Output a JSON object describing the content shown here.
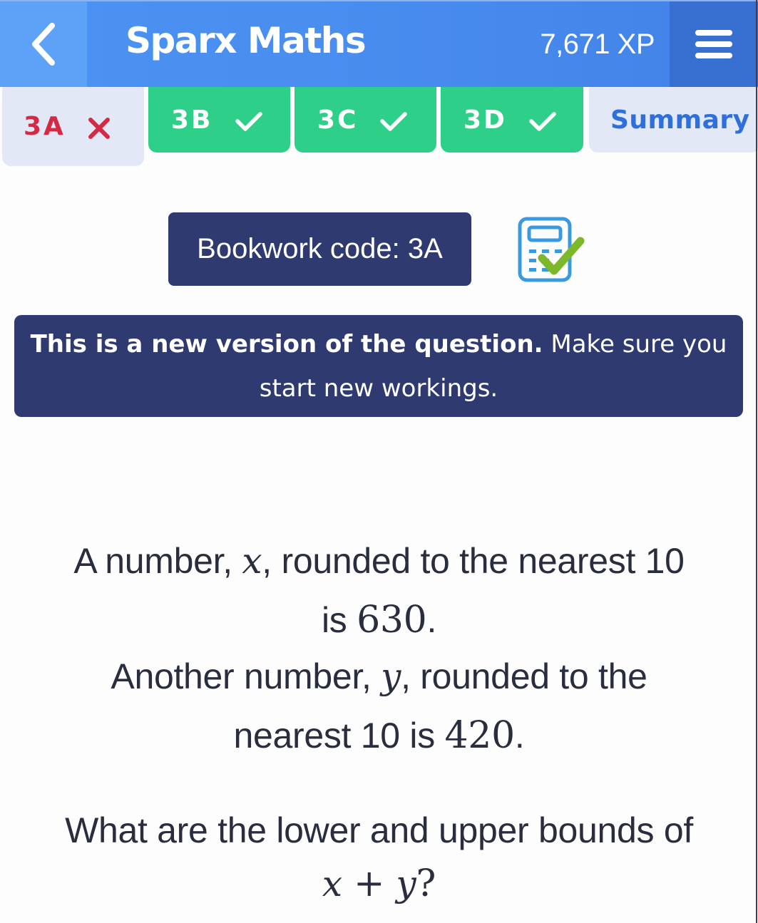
{
  "header": {
    "back_icon": "chevron-left-icon",
    "title": "Sparx Maths",
    "xp": "7,671 XP",
    "menu_icon": "hamburger-menu-icon"
  },
  "tabs": [
    {
      "label": "3A",
      "status": "incorrect",
      "status_icon": "cross-icon"
    },
    {
      "label": "3B",
      "status": "correct",
      "status_icon": "check-icon"
    },
    {
      "label": "3C",
      "status": "correct",
      "status_icon": "check-icon"
    },
    {
      "label": "3D",
      "status": "correct",
      "status_icon": "check-icon"
    },
    {
      "label": "Summary"
    }
  ],
  "bookwork": {
    "label": "Bookwork code: 3A",
    "check_icon": "calculator-check-icon"
  },
  "notice": {
    "bold": "This is a new version of the question.",
    "rest": " Make sure you start new workings."
  },
  "question": {
    "line1_a": "A number, ",
    "var_x": "x",
    "line1_b": ", rounded to the nearest 10",
    "line2_a": "is ",
    "value_x": "630",
    "line2_b": ".",
    "line3_a": "Another number, ",
    "var_y": "y",
    "line3_b": ", rounded to the",
    "line4_a": "nearest 10 is ",
    "value_y": "420",
    "line4_b": ".",
    "line5": "What are the lower and upper bounds of",
    "expr_x": "x",
    "expr_op": " + ",
    "expr_y": "y",
    "expr_q": "?"
  },
  "colors": {
    "header_blue": "#4a8ef0",
    "correct_green": "#2ecf89",
    "incorrect_red": "#d42a45",
    "summary_blue": "#2f6fdc",
    "navy": "#2e3a70"
  }
}
